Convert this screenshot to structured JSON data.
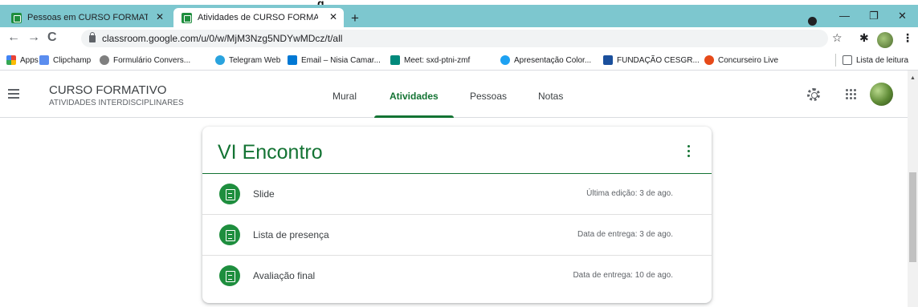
{
  "page_fragment": "g",
  "browser": {
    "tabs": [
      {
        "title": "Pessoas em CURSO FORMATIVO",
        "active": false
      },
      {
        "title": "Atividades de CURSO FORMATIVO",
        "active": true
      }
    ],
    "new_tab": "+",
    "url": "classroom.google.com/u/0/w/MjM3Nzg5NDYwMDcz/t/all",
    "bookmarks": [
      {
        "label": "Apps",
        "icon": "apps-grid-icon",
        "color": "#ea4335"
      },
      {
        "label": "Clipchamp",
        "icon": "clipchamp-icon",
        "color": "#5b8def"
      },
      {
        "label": "Formulário Convers...",
        "icon": "form-icon",
        "color": "#7f7f7f"
      },
      {
        "label": "Telegram Web",
        "icon": "telegram-icon",
        "color": "#2aa3de"
      },
      {
        "label": "Email – Nisia Camar...",
        "icon": "outlook-icon",
        "color": "#0078d4"
      },
      {
        "label": "Meet: sxd-ptni-zmf",
        "icon": "meet-icon",
        "color": "#00897b"
      },
      {
        "label": "Apresentação Color...",
        "icon": "canva-icon",
        "color": "#1da1f2"
      },
      {
        "label": "FUNDAÇÃO CESGR...",
        "icon": "cesgranrio-icon",
        "color": "#1a4f9c"
      },
      {
        "label": "Concurseiro Live",
        "icon": "concurseiro-icon",
        "color": "#e64a19"
      }
    ],
    "reading_list": "Lista de leitura"
  },
  "classroom": {
    "course_name": "CURSO FORMATIVO",
    "course_section": "ATIVIDADES INTERDISCIPLINARES",
    "nav_tabs": [
      {
        "label": "Mural"
      },
      {
        "label": "Atividades",
        "active": true
      },
      {
        "label": "Pessoas"
      },
      {
        "label": "Notas"
      }
    ],
    "accent": "#137333"
  },
  "topic": {
    "title": "VI Encontro",
    "items": [
      {
        "name": "Slide",
        "meta": "Última edição: 3 de ago."
      },
      {
        "name": "Lista de presença",
        "meta": "Data de entrega: 3 de ago."
      },
      {
        "name": "Avaliação final",
        "meta": "Data de entrega: 10 de ago."
      }
    ]
  }
}
